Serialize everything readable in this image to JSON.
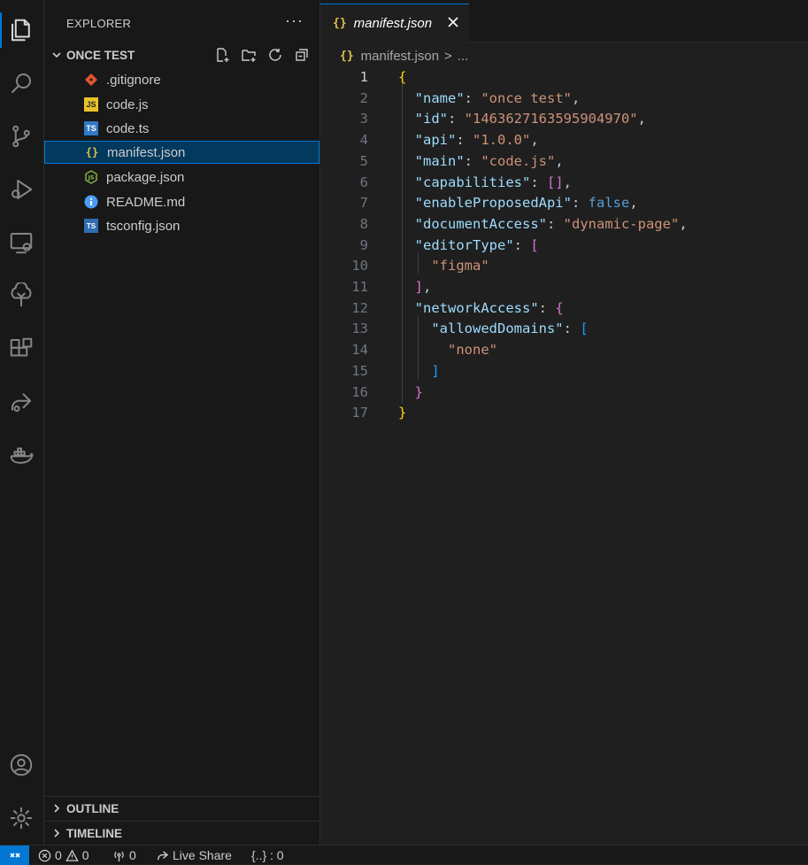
{
  "activity_bar": {
    "items": [
      "explorer-icon",
      "search-icon",
      "source-control-icon",
      "run-debug-icon",
      "remote-explorer-icon",
      "tree-icon",
      "extensions-icon",
      "live-share-icon",
      "docker-icon"
    ],
    "bottom": [
      "account-icon",
      "settings-gear-icon"
    ]
  },
  "sidebar": {
    "title": "EXPLORER",
    "more": "···",
    "folder": "ONCE TEST",
    "files": [
      {
        "name": ".gitignore",
        "icon": "git-icon"
      },
      {
        "name": "code.js",
        "icon": "js-icon"
      },
      {
        "name": "code.ts",
        "icon": "ts-icon"
      },
      {
        "name": "manifest.json",
        "icon": "json-icon"
      },
      {
        "name": "package.json",
        "icon": "node-icon"
      },
      {
        "name": "README.md",
        "icon": "info-icon"
      },
      {
        "name": "tsconfig.json",
        "icon": "tsconfig-icon"
      }
    ],
    "sections": [
      "OUTLINE",
      "TIMELINE"
    ]
  },
  "tab": {
    "icon": "{}",
    "label": "manifest.json"
  },
  "breadcrumb": {
    "icon": "{}",
    "file": "manifest.json",
    "sep": ">",
    "more": "..."
  },
  "editor": {
    "line_numbers": [
      "1",
      "2",
      "3",
      "4",
      "5",
      "6",
      "7",
      "8",
      "9",
      "10",
      "11",
      "12",
      "13",
      "14",
      "15",
      "16",
      "17"
    ],
    "current_line": "1",
    "tokens": {
      "name_key": "\"name\"",
      "name_val": "\"once test\"",
      "id_key": "\"id\"",
      "id_val": "\"1463627163595904970\"",
      "api_key": "\"api\"",
      "api_val": "\"1.0.0\"",
      "main_key": "\"main\"",
      "main_val": "\"code.js\"",
      "cap_key": "\"capabilities\"",
      "epa_key": "\"enableProposedApi\"",
      "epa_val": "false",
      "da_key": "\"documentAccess\"",
      "da_val": "\"dynamic-page\"",
      "et_key": "\"editorType\"",
      "et_item": "\"figma\"",
      "na_key": "\"networkAccess\"",
      "ad_key": "\"allowedDomains\"",
      "ad_item": "\"none\""
    }
  },
  "status_bar": {
    "errors": "0",
    "warnings": "0",
    "ports": "0",
    "live_share": "Live Share",
    "json_status": "{..} : 0"
  }
}
